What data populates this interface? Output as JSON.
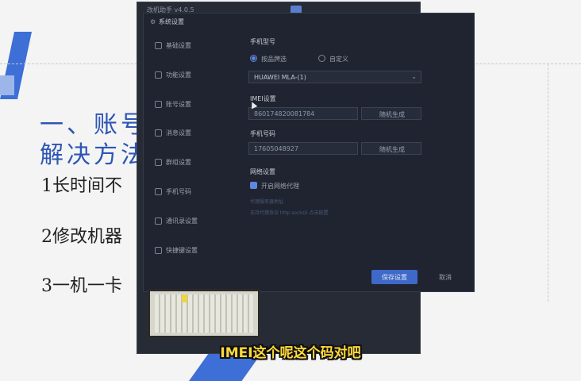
{
  "slide": {
    "heading_line1": "一、账号",
    "heading_line2": "解决方法",
    "items": [
      "1长时间不",
      "2修改机器",
      "3一机一卡"
    ]
  },
  "back_window": {
    "title": "改机助手 v4.0.5"
  },
  "dialog": {
    "title": "系统设置",
    "sidebar": [
      {
        "label": "基础设置",
        "icon": "gear-icon"
      },
      {
        "label": "功能设置",
        "icon": "sliders-icon"
      },
      {
        "label": "账号设置",
        "icon": "user-icon"
      },
      {
        "label": "消息设置",
        "icon": "message-icon"
      },
      {
        "label": "群组设置",
        "icon": "group-icon"
      },
      {
        "label": "手机号码",
        "icon": "phone-icon"
      },
      {
        "label": "通讯录设置",
        "icon": "contacts-icon"
      },
      {
        "label": "快捷键设置",
        "icon": "keyboard-icon"
      }
    ],
    "model_section": {
      "label": "手机型号",
      "options": [
        "按品牌选",
        "自定义"
      ],
      "selected_value": "HUAWEI MLA-(1)"
    },
    "imei_section": {
      "label": "IMEI设置",
      "value": "860174820081784",
      "random_label": "随机生成"
    },
    "phone_section": {
      "label": "手机号码",
      "value": "17605048927",
      "random_label": "随机生成"
    },
    "network_section": {
      "label": "网络设置",
      "checkbox_label": "开启网络代理",
      "hint1": "代理服务器地址",
      "hint2": "支持代理协议 http socks5 点击配置"
    },
    "ok_label": "保存设置",
    "cancel_label": "取消"
  },
  "subtitle": "IMEI这个呢这个码对吧",
  "colors": {
    "accent_blue": "#3f69c8",
    "dialog_bg": "#1f2430",
    "subtitle_yellow": "#ffd93b",
    "heading_blue": "#2d55b4"
  }
}
